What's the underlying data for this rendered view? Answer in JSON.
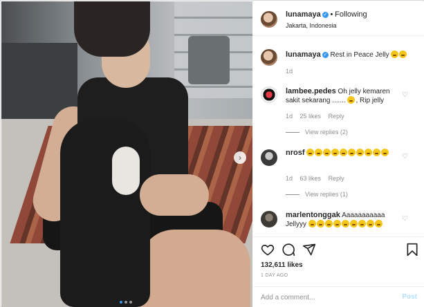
{
  "post": {
    "author": "lunamaya",
    "follow_sep": "•",
    "follow_status": "Following",
    "location": "Jakarta, Indonesia"
  },
  "caption": {
    "username": "lunamaya",
    "text": "Rest in Peace Jelly",
    "emoji_count": 2,
    "time": "1d"
  },
  "carousel": {
    "slides": 3,
    "active_index": 0,
    "next_icon": "chevron-right-icon"
  },
  "comments": [
    {
      "username": "lambee.pedes",
      "text": "Oh jelly kemaren sakit sekarang ....... ",
      "text_after": ", Rip jelly",
      "emoji_count": 1,
      "time": "1d",
      "likes": "25 likes",
      "reply": "Reply",
      "view_replies": "View replies (2)"
    },
    {
      "username": "nrosf",
      "emoji_count": 10,
      "time": "1d",
      "likes": "63 likes",
      "reply": "Reply",
      "view_replies": "View replies (1)"
    },
    {
      "username": "marlentonggak",
      "text": "Aaaaaaaaaaa Jellyyy",
      "emoji_count": 9
    }
  ],
  "stats": {
    "likes": "132,611 likes",
    "date": "1 DAY AGO"
  },
  "add_comment": {
    "placeholder": "Add a comment...",
    "post_label": "Post"
  },
  "colors": {
    "verified": "#3897f0",
    "post_disabled": "#b2dffc",
    "muted": "#8e8e8e"
  },
  "icons": [
    "heart-icon",
    "comment-icon",
    "share-icon",
    "bookmark-icon",
    "verified-icon",
    "chevron-right-icon"
  ]
}
